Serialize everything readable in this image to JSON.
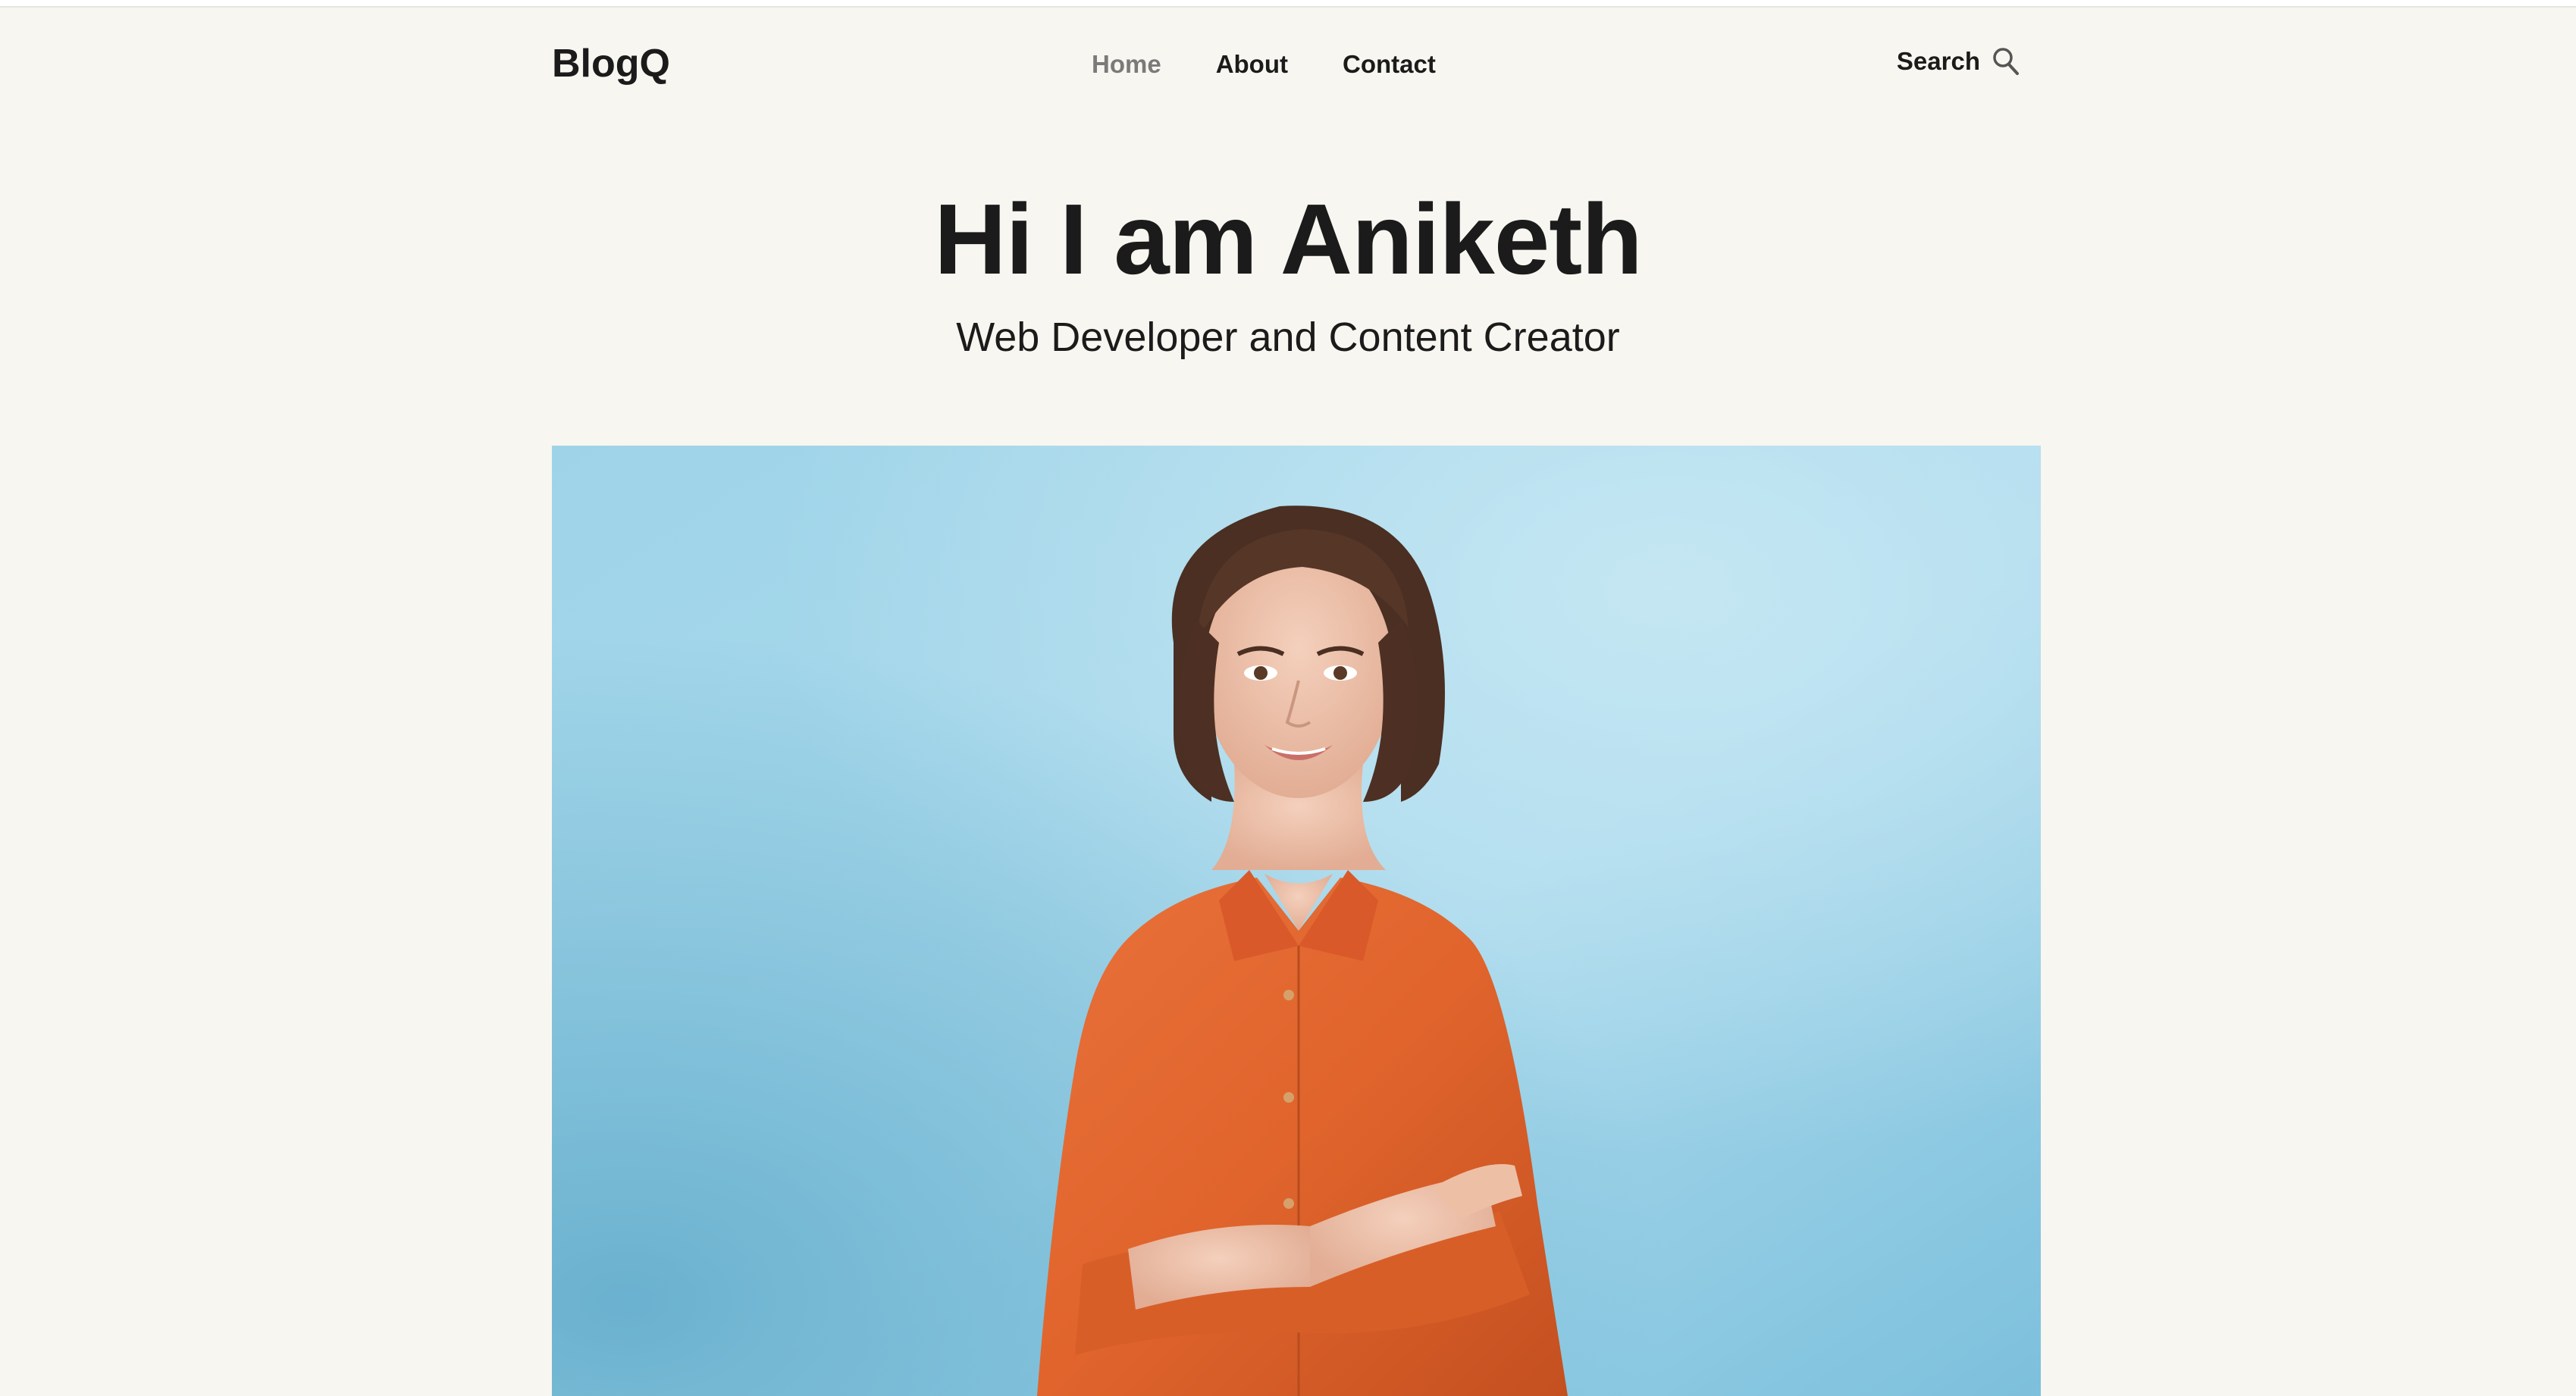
{
  "site": {
    "logo": "BlogQ"
  },
  "nav": {
    "items": [
      {
        "label": "Home",
        "active": true
      },
      {
        "label": "About",
        "active": false
      },
      {
        "label": "Contact",
        "active": false
      }
    ],
    "search_label": "Search",
    "search_icon": "search-icon"
  },
  "hero": {
    "title": "Hi I am Aniketh",
    "subtitle": "Web Developer and Content Creator",
    "image_icon": "portrait-photo"
  },
  "colors": {
    "background": "#f8f6f0",
    "text": "#1b1b1b",
    "nav_active": "#7a7a7a",
    "photo_backdrop": "#8fcbe2",
    "shirt": "#e0642c"
  }
}
